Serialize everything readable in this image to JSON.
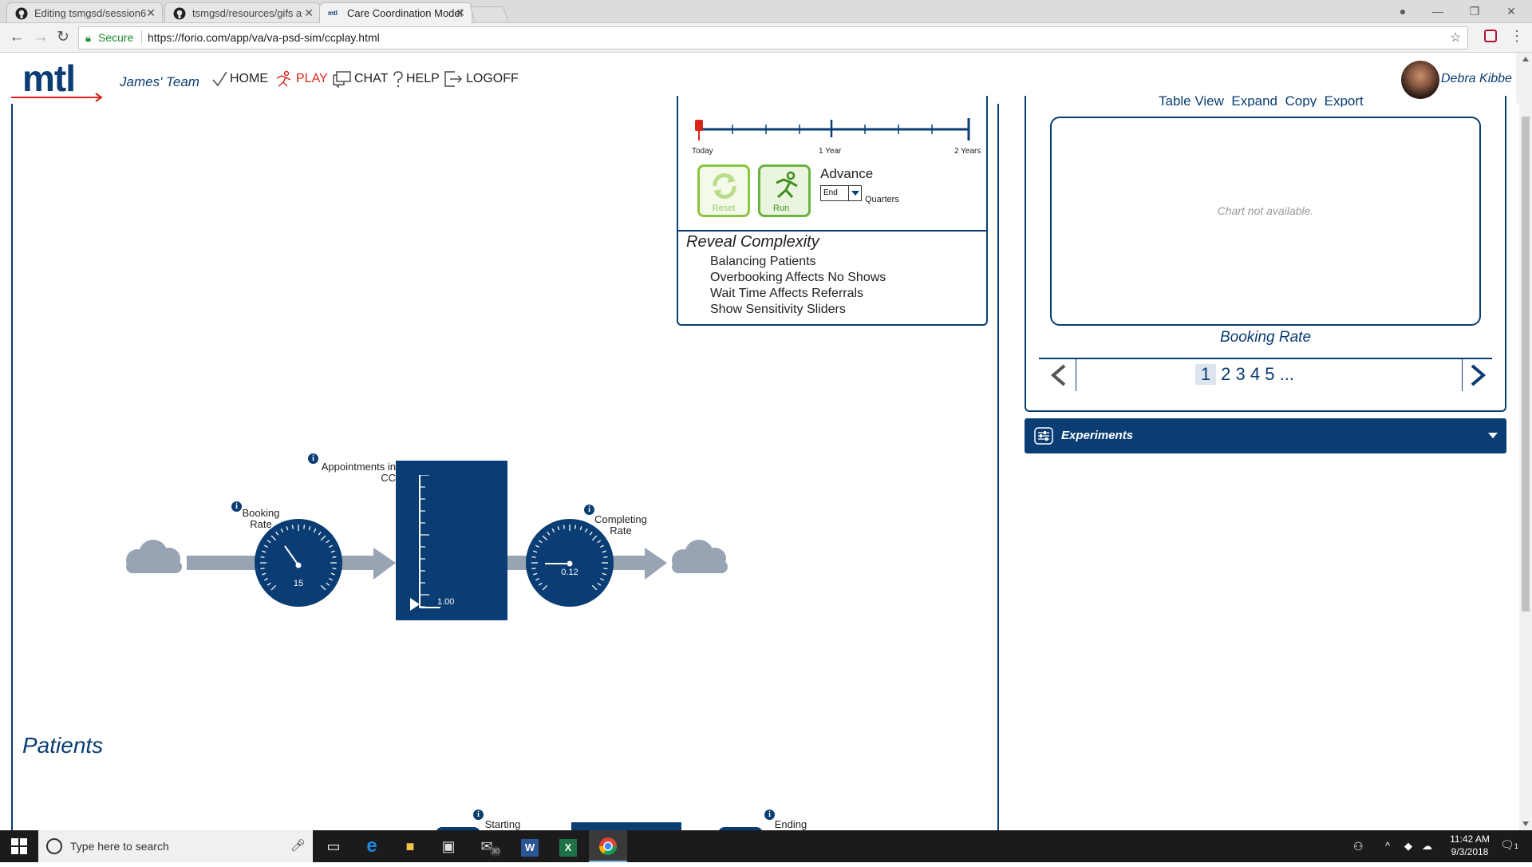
{
  "browser": {
    "tabs": [
      {
        "label": "Editing tsmgsd/session6"
      },
      {
        "label": "tsmgsd/resources/gifs a"
      },
      {
        "label": "Care Coordination Model"
      }
    ],
    "secure_label": "Secure",
    "url": "https://forio.com/app/va/va-psd-sim/ccplay.html"
  },
  "app": {
    "logo": "mtl",
    "team": "James' Team",
    "nav": [
      {
        "label": "HOME",
        "icon": "check-icon"
      },
      {
        "label": "PLAY",
        "icon": "runner-icon"
      },
      {
        "label": "CHAT",
        "icon": "chat-icon"
      },
      {
        "label": "HELP",
        "icon": "question-icon"
      },
      {
        "label": "LOGOFF",
        "icon": "logoff-icon"
      }
    ],
    "user_name": "Debra Kibbe",
    "accent_color": "#0a3d73",
    "active_nav_color": "#d9241a"
  },
  "timeline": {
    "labels": [
      "Today",
      "1 Year",
      "2 Years"
    ],
    "progress": 0
  },
  "controls": {
    "reset_label": "Reset",
    "run_label": "Run",
    "advance_label": "Advance",
    "advance_select_value": "End",
    "unit_label": "Quarters"
  },
  "reveal": {
    "title": "Reveal Complexity",
    "items": [
      "Balancing Patients",
      "Overbooking Affects No Shows",
      "Wait Time Affects Referrals",
      "Show Sensitivity Sliders"
    ]
  },
  "chart_panel": {
    "actions": [
      "Table View",
      "Expand",
      "Copy",
      "Export"
    ],
    "empty_message": "Chart not available.",
    "chart_title": "Booking Rate",
    "pages": [
      "1",
      "2",
      "3",
      "4",
      "5",
      "..."
    ],
    "current_page": "1"
  },
  "experiments": {
    "label": "Experiments"
  },
  "diagram": {
    "booking": {
      "label": "Booking Rate",
      "value": "15"
    },
    "appointments": {
      "label": "Appointments in CC",
      "value": "1.00"
    },
    "completing": {
      "label": "Completing Rate",
      "value": "0.12"
    }
  },
  "patients": {
    "title": "Patients",
    "starting_label": "Starting",
    "ending_label": "Ending"
  },
  "taskbar": {
    "search_placeholder": "Type here to search",
    "mail_badge": "30",
    "time": "11:42 AM",
    "date": "9/3/2018",
    "notification_count": "1"
  }
}
